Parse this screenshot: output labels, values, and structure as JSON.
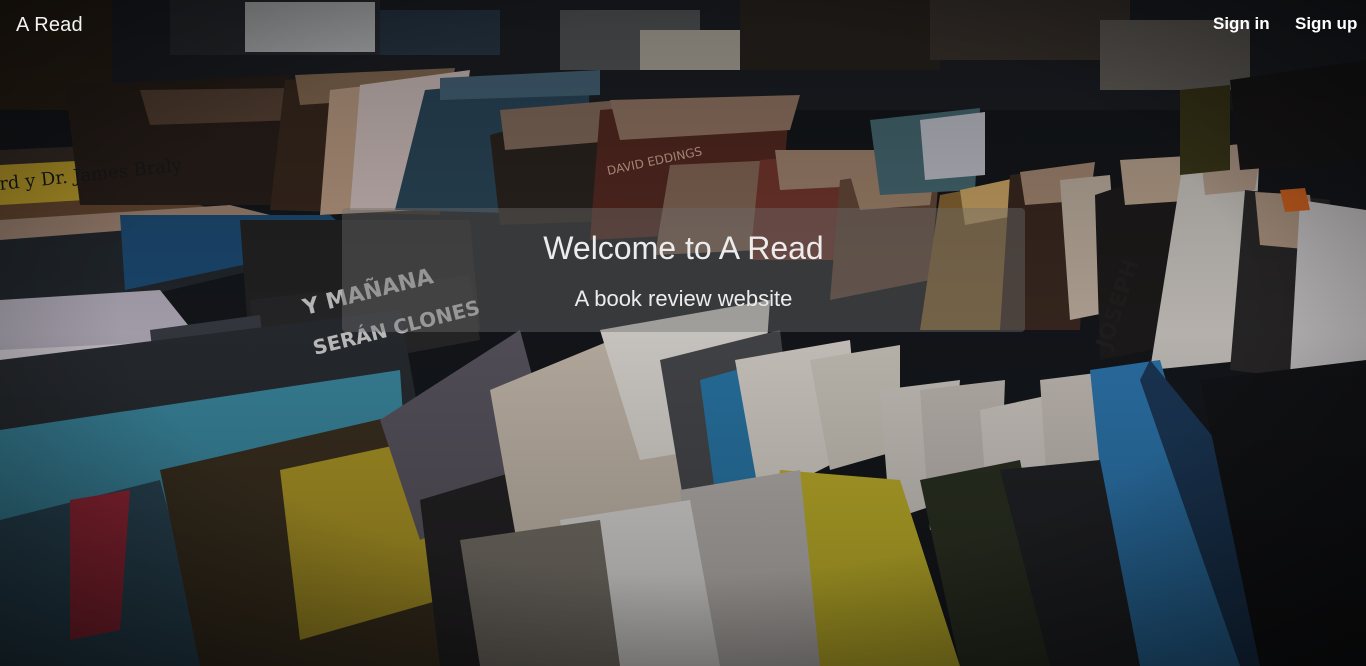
{
  "navbar": {
    "brand": "A Read",
    "sign_in": "Sign in",
    "sign_up": "Sign up"
  },
  "hero": {
    "title": "Welcome to A Read",
    "subtitle": "A book review website",
    "background_image": "blurred-bookshelf-photo",
    "book_spine_texts": [
      "rd y Dr. James Braly",
      "Y MAÑANA",
      "SERÁN CLONES",
      "DAVID EDDINGS",
      "JOSEPH"
    ]
  },
  "colors": {
    "text": "#ececec",
    "overlay": "#6e6e6e",
    "background": "#0b0d10"
  }
}
